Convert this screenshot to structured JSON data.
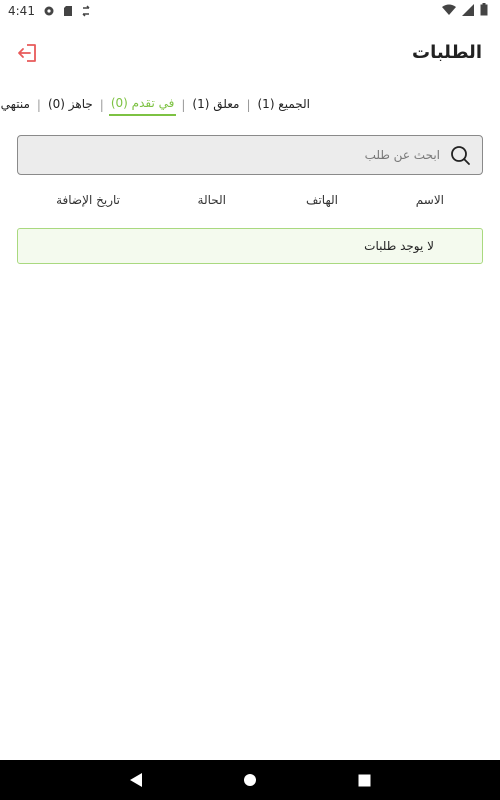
{
  "status_bar": {
    "time": "4:41",
    "icons": [
      "notification-icon",
      "sd-card-icon",
      "sync-icon",
      "wifi-icon",
      "signal-icon",
      "battery-icon"
    ]
  },
  "header": {
    "title": "الطلبات",
    "logout_icon": "logout-icon",
    "accent_color": "#e85a5a"
  },
  "tabs": [
    {
      "label": "الجميع (1)",
      "active": false
    },
    {
      "label": "معلق (1)",
      "active": false
    },
    {
      "label": "في تقدم (0)",
      "active": true
    },
    {
      "label": "جاهز (0)",
      "active": false
    },
    {
      "label": "منتهي (0)",
      "active": false
    }
  ],
  "tab_separator": "|",
  "active_color": "#7dc243",
  "search": {
    "placeholder": "ابحث عن طلب",
    "value": ""
  },
  "columns": {
    "name": "الاسم",
    "phone": "الهاتف",
    "status": "الحالة",
    "date": "تاريخ الإضافة"
  },
  "empty_message": "لا يوجد طلبات",
  "nav_bar": {
    "icons": [
      "back-icon",
      "home-icon",
      "recents-icon"
    ]
  }
}
